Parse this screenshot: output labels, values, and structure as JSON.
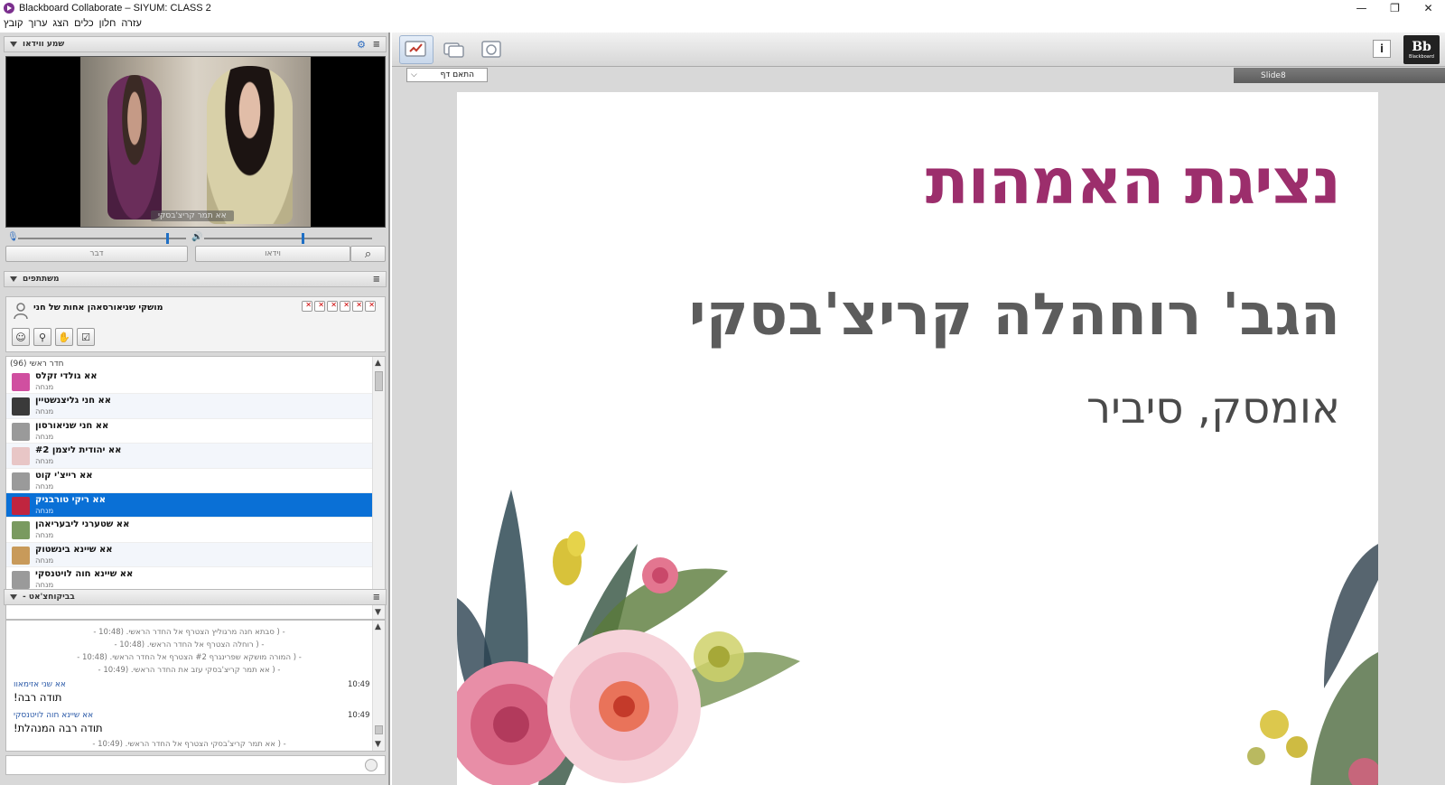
{
  "window": {
    "title": "Blackboard Collaborate – SIYUM: CLASS 2",
    "minimize": "—",
    "restore": "❐",
    "close": "✕"
  },
  "menu": [
    "קובץ",
    "ערוך",
    "הצג",
    "כלים",
    "חלון",
    "עזרה"
  ],
  "audio_video": {
    "header": "שמע ווידאו",
    "caption": "אא תמר קריצ'בסקי",
    "talk_button": "דבר",
    "video_button": "וידאו",
    "mic_level": 0.88,
    "speaker_level": 0.58
  },
  "participants": {
    "header": "משתתפים",
    "current_user": "מושקי שניאורסאהן אחות של חני",
    "room_label": "חדר ראשי (96)",
    "rows": [
      {
        "name": "אא גולדי זקלס",
        "role": "מנחה",
        "avatar_color": "#d04fa0"
      },
      {
        "name": "אא חני גליצנשטיין",
        "role": "מנחה",
        "avatar_color": "#3a3a3a"
      },
      {
        "name": "אא חני שניאורסון",
        "role": "מנחה",
        "avatar_color": "#9a9a9a"
      },
      {
        "name": "אא יהודית ליצמן #2",
        "role": "מנחה",
        "avatar_color": "#e8c6c6"
      },
      {
        "name": "אא רייצ'י קוט",
        "role": "מנחה",
        "avatar_color": "#9a9a9a"
      },
      {
        "name": "אא ריקי טורבניק",
        "role": "מנחה",
        "avatar_color": "#c0253f",
        "selected": true
      },
      {
        "name": "אא שטערני ליבעריאהן",
        "role": "מנחה",
        "avatar_color": "#7a9a60"
      },
      {
        "name": "אא שיינא בינשטוק",
        "role": "מנחה",
        "avatar_color": "#c89a5a"
      },
      {
        "name": "אא שיינא חוה לויטנסקי",
        "role": "מנחה",
        "avatar_color": "#9a9a9a"
      }
    ]
  },
  "chat": {
    "header": "- בביקוחצ'אט",
    "system_lines": [
      "- ( סבתא חנה מרגוליץ הצטרף אל החדר הראשי. (10:48 -",
      "- ( רוחלה הצטרף אל החדר הראשי. (10:48 -",
      "- ( המורה מושקא שפרינגרף #2 הצטרף אל החדר הראשי. (10:48 -",
      "- ( אא תמר קריצ'בסקי עזב את החדר הראשי. (10:49 -"
    ],
    "messages": [
      {
        "author": "אא שני אזימאוו",
        "time": "10:49",
        "text": "תודה רבה!"
      },
      {
        "author": "אא שיינא חוה לויטנסקי",
        "time": "10:49",
        "text": "תודה רבה המנהלת!"
      }
    ],
    "last_system": "- ( אא תמר קריצ'בסקי הצטרף אל החדר הראשי. (10:49 -"
  },
  "whiteboard": {
    "fit_option": "התאם דף",
    "slide_label": "Slide8",
    "info": "i",
    "logo": "Bb",
    "logo_sub": "Blackboard",
    "slide": {
      "title": "נציגת האמהות",
      "name": "הגב' רוחהלה קריצ'בסקי",
      "place": "אומסק, סיביר"
    }
  }
}
